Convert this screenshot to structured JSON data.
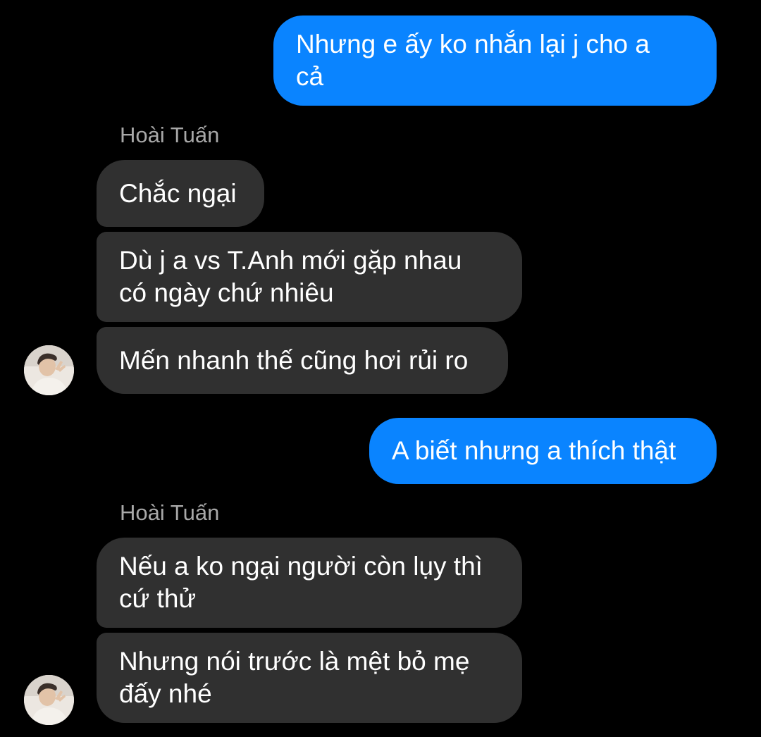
{
  "colors": {
    "background": "#000000",
    "outgoing_bubble": "#0a84ff",
    "incoming_bubble": "#303030",
    "sender_name": "#a8a8a8",
    "text": "#ffffff"
  },
  "messages": [
    {
      "direction": "outgoing",
      "text": "Nhưng e ấy ko nhắn lại j cho a\ncả"
    },
    {
      "direction": "sender-label",
      "text": "Hoài Tuấn"
    },
    {
      "direction": "incoming",
      "text": "Chắc ngại"
    },
    {
      "direction": "incoming",
      "text": "Dù j a vs T.Anh mới gặp nhau\ncó ngày chứ nhiêu"
    },
    {
      "direction": "incoming",
      "text": "Mến nhanh thế cũng hơi rủi ro",
      "avatar": "avatar-photo"
    },
    {
      "direction": "outgoing",
      "text": "A biết nhưng a thích thật"
    },
    {
      "direction": "sender-label",
      "text": "Hoài Tuấn"
    },
    {
      "direction": "incoming",
      "text": "Nếu a ko ngại người còn lụy thì\ncứ thử"
    },
    {
      "direction": "incoming",
      "text": "Nhưng nói trước là mệt bỏ mẹ\nđấy nhé",
      "avatar": "avatar-photo"
    }
  ]
}
